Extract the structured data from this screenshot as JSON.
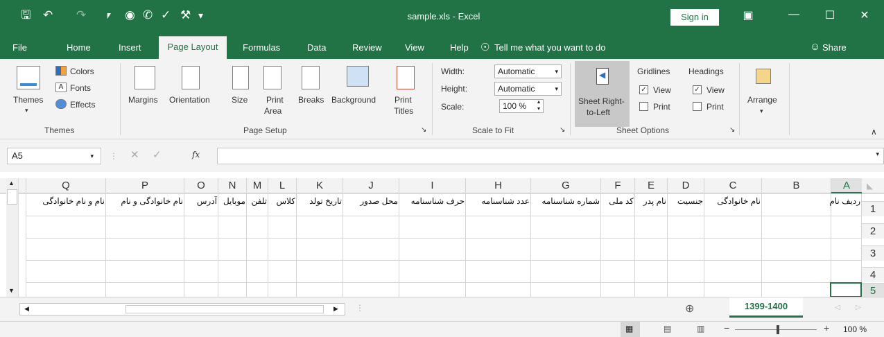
{
  "app": {
    "title": "sample.xls - Excel",
    "sign_in": "Sign in"
  },
  "tabs": [
    "File",
    "Home",
    "Insert",
    "Page Layout",
    "Formulas",
    "Data",
    "Review",
    "View",
    "Help"
  ],
  "tell_me": "Tell me what you want to do",
  "share": "Share",
  "ribbon": {
    "themes": {
      "themes_label": "Themes",
      "colors": "Colors",
      "fonts": "Fonts",
      "effects": "Effects",
      "group": "Themes"
    },
    "page_setup": {
      "margins": "Margins",
      "orientation": "Orientation",
      "size": "Size",
      "print_area_1": "Print",
      "print_area_2": "Area",
      "breaks": "Breaks",
      "background": "Background",
      "print_titles_1": "Print",
      "print_titles_2": "Titles",
      "group": "Page Setup"
    },
    "scale_to_fit": {
      "width_label": "Width:",
      "width_value": "Automatic",
      "height_label": "Height:",
      "height_value": "Automatic",
      "scale_label": "Scale:",
      "scale_value": "100 %",
      "group": "Scale to Fit"
    },
    "sheet_options": {
      "rtl_1": "Sheet Right-",
      "rtl_2": "to-Left",
      "gridlines": "Gridlines",
      "headings": "Headings",
      "view": "View",
      "print": "Print",
      "group": "Sheet Options"
    },
    "arrange": {
      "label": "Arrange"
    }
  },
  "name_box": "A5",
  "columns": [
    "A",
    "B",
    "C",
    "D",
    "E",
    "F",
    "G",
    "H",
    "I",
    "J",
    "K",
    "L",
    "M",
    "N",
    "O",
    "P",
    "Q"
  ],
  "rows": [
    "1",
    "2",
    "3",
    "4",
    "5"
  ],
  "row1": {
    "A": "ردیف نام",
    "C": "نام خانوادگی",
    "D": "جنسیت",
    "E": "نام پدر",
    "F": "کد ملی",
    "G": "شماره شناسنامه",
    "H": "عدد شناسنامه",
    "I": "حرف شناسنامه",
    "J": "محل صدور",
    "K": "تاریخ تولد",
    "L": "کلاس",
    "M": "تلفن",
    "N": "موبایل",
    "O": "آدرس",
    "P": "نام خانوادگی و نام",
    "Q": "نام و نام خانوادگی"
  },
  "sheet_tab": "1399-1400",
  "zoom": "100 %",
  "colors": {
    "accent": "#217346"
  }
}
